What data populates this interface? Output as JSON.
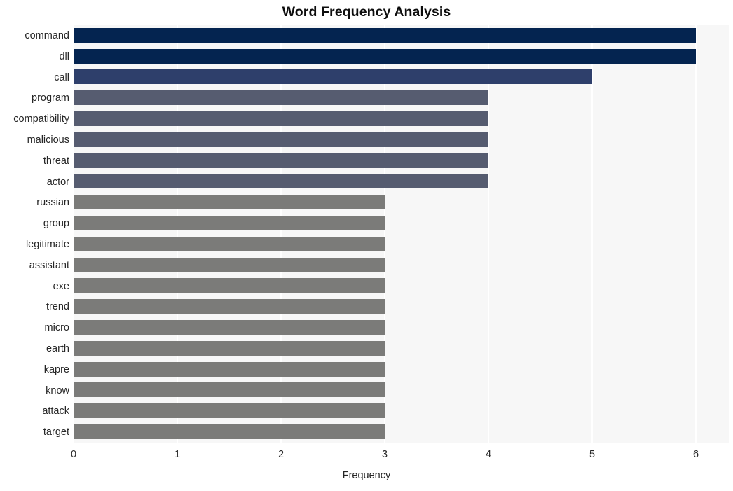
{
  "chart_data": {
    "type": "bar",
    "orientation": "horizontal",
    "title": "Word Frequency Analysis",
    "xlabel": "Frequency",
    "ylabel": "",
    "xlim": [
      0,
      6
    ],
    "xticks": [
      0,
      1,
      2,
      3,
      4,
      5,
      6
    ],
    "xtick_labels": [
      "0",
      "1",
      "2",
      "3",
      "4",
      "5",
      "6"
    ],
    "grid": true,
    "grid_axis": "x",
    "grid_color": "#ffffff",
    "plot_background": "#f7f7f7",
    "figure_background": "#ffffff",
    "legend": null,
    "categories": [
      "command",
      "dll",
      "call",
      "program",
      "compatibility",
      "malicious",
      "threat",
      "actor",
      "russian",
      "group",
      "legitimate",
      "assistant",
      "exe",
      "trend",
      "micro",
      "earth",
      "kapre",
      "know",
      "attack",
      "target"
    ],
    "values": [
      6,
      6,
      5,
      4,
      4,
      4,
      4,
      4,
      3,
      3,
      3,
      3,
      3,
      3,
      3,
      3,
      3,
      3,
      3,
      3
    ],
    "bar_colors": [
      "#042450",
      "#042450",
      "#2e3f6b",
      "#565c70",
      "#565c70",
      "#565c70",
      "#565c70",
      "#565c70",
      "#7b7b79",
      "#7b7b79",
      "#7b7b79",
      "#7b7b79",
      "#7b7b79",
      "#7b7b79",
      "#7b7b79",
      "#7b7b79",
      "#7b7b79",
      "#7b7b79",
      "#7b7b79",
      "#7b7b79"
    ]
  }
}
